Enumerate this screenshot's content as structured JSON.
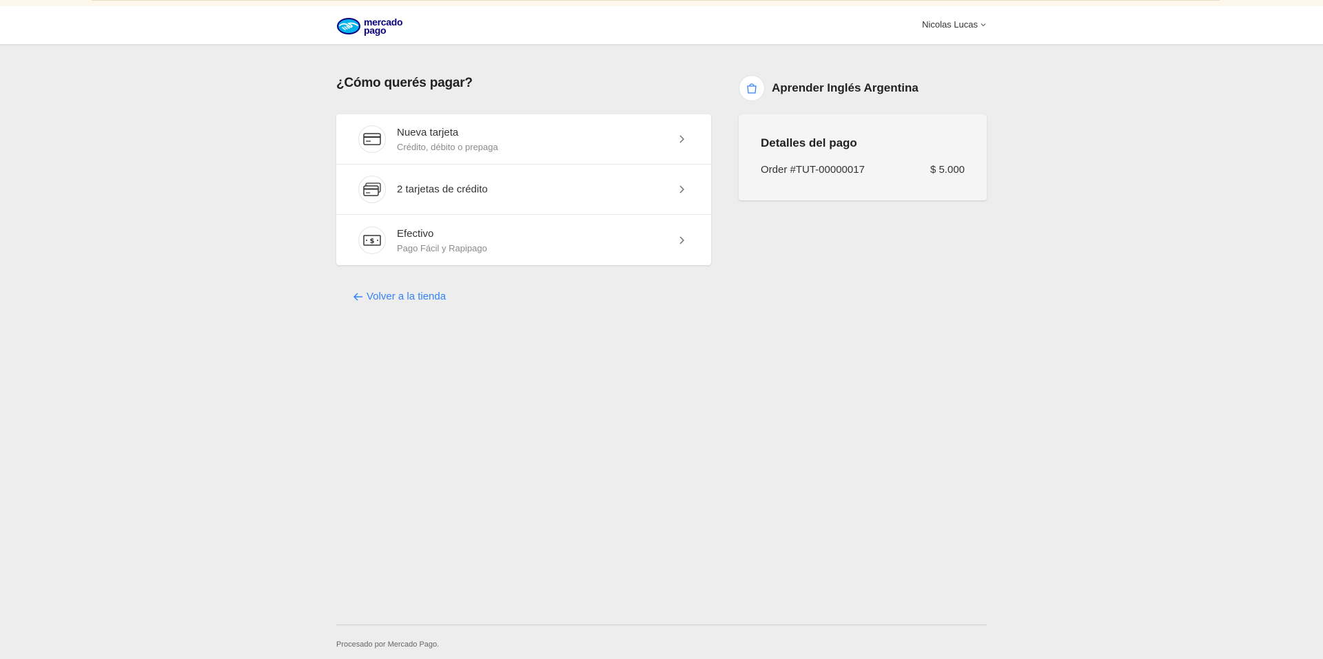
{
  "header": {
    "logo_line1": "mercado",
    "logo_line2": "pago",
    "user_name": "Nicolas Lucas"
  },
  "main": {
    "title": "¿Cómo querés pagar?",
    "options": [
      {
        "title": "Nueva tarjeta",
        "subtitle": "Crédito, débito o prepaga",
        "icon": "credit-card-icon"
      },
      {
        "title": "2 tarjetas de crédito",
        "subtitle": "",
        "icon": "stacked-cards-icon"
      },
      {
        "title": "Efectivo",
        "subtitle": "Pago Fácil y Rapipago",
        "icon": "cash-icon"
      }
    ],
    "back_link": "Volver a la tienda"
  },
  "sidebar": {
    "product_name": "Aprender Inglés Argentina",
    "details_title": "Detalles del pago",
    "order_label": "Order #TUT-00000017",
    "order_amount": "$ 5.000"
  },
  "footer": {
    "text": "Procesado por Mercado Pago."
  },
  "colors": {
    "accent": "#3483fa",
    "background": "#ededed",
    "brand_navy": "#0a0080"
  }
}
